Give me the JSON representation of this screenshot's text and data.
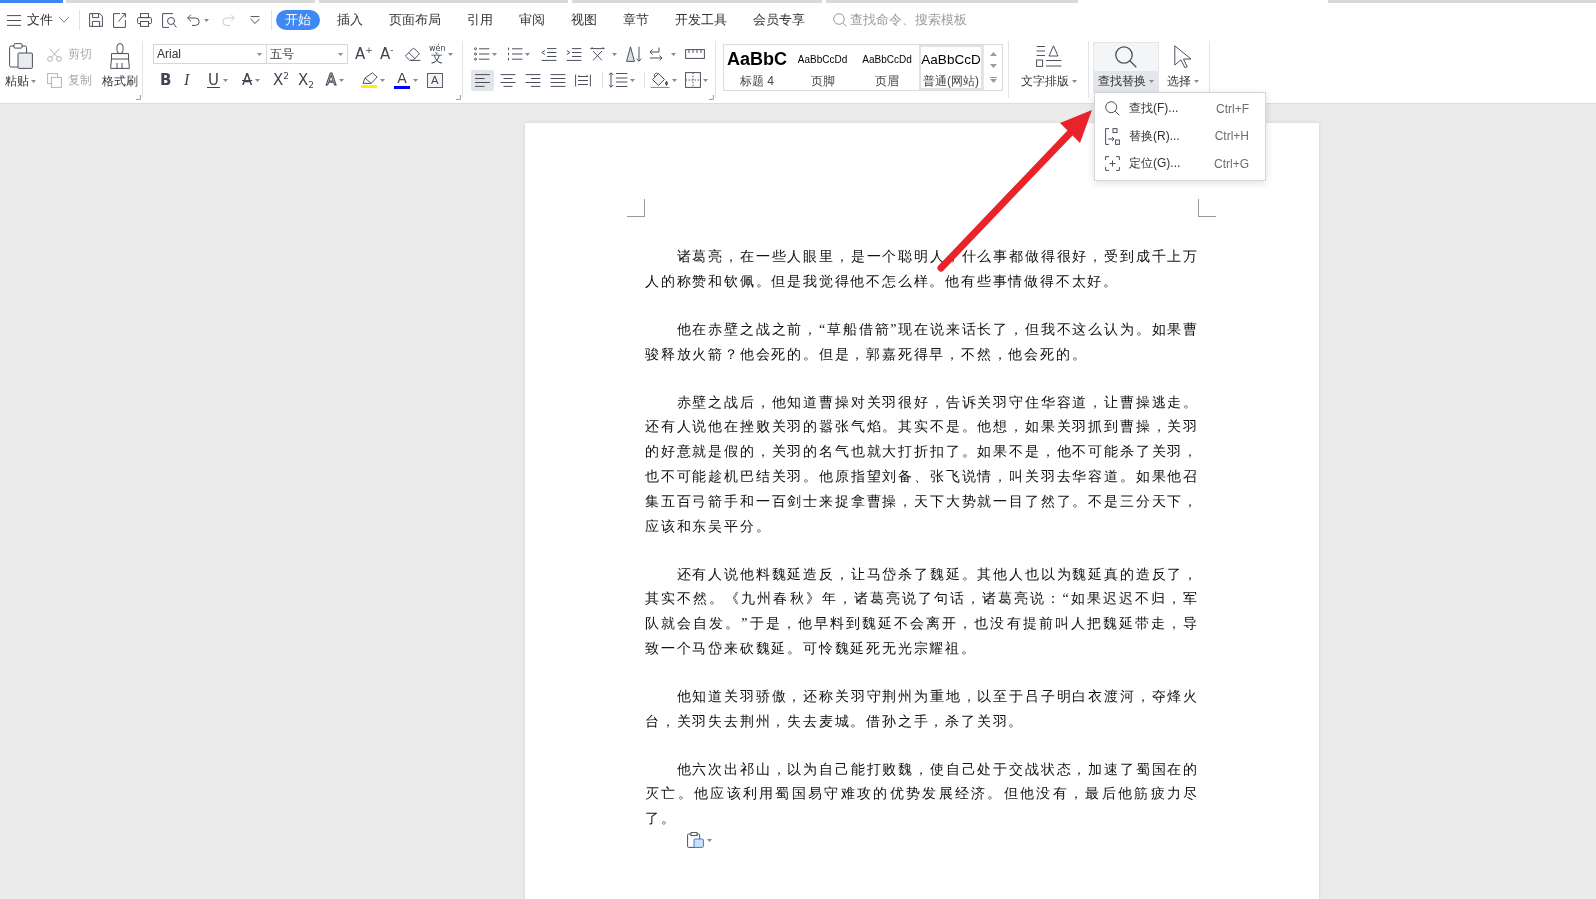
{
  "menu_bar": {
    "file_menu": "文件",
    "quick_access": [
      {
        "kind": "save",
        "disabled": false
      },
      {
        "kind": "export",
        "disabled": false
      },
      {
        "kind": "print",
        "disabled": false
      },
      {
        "kind": "print-preview",
        "disabled": false
      },
      {
        "kind": "undo",
        "disabled": false
      },
      {
        "kind": "redo",
        "disabled": true
      },
      {
        "kind": "customize",
        "disabled": false
      }
    ],
    "search": {
      "placeholder": "查找命令、搜索模板"
    }
  },
  "tabs": [
    {
      "label": "开始",
      "selected": true
    },
    {
      "label": "插入",
      "selected": false
    },
    {
      "label": "页面布局",
      "selected": false
    },
    {
      "label": "引用",
      "selected": false
    },
    {
      "label": "审阅",
      "selected": false
    },
    {
      "label": "视图",
      "selected": false
    },
    {
      "label": "章节",
      "selected": false
    },
    {
      "label": "开发工具",
      "selected": false
    },
    {
      "label": "会员专享",
      "selected": false
    }
  ],
  "ribbon": {
    "clipboard": {
      "paste": "粘贴",
      "cut": {
        "label": "剪切",
        "disabled": true
      },
      "copy": {
        "label": "复制",
        "disabled": true
      },
      "format_painter": "格式刷"
    },
    "font": {
      "font_name": "Arial",
      "font_size": "五号",
      "grow_font": "A$^{+}$",
      "shrink_font": "A$^{-}$",
      "phonetic_guide": {
        "pinyin": "wén",
        "character": "文"
      },
      "bold": "B",
      "italic": "I",
      "underline": "U",
      "strikethrough": "A",
      "superscript": "X$^{2}$",
      "subscript": "X$_{2}$",
      "text_effect": "A",
      "font_color": "A",
      "character_border": "A"
    },
    "paragraph": {
      "alignment": [
        {
          "kind": "left",
          "selected": true
        },
        {
          "kind": "center",
          "selected": false
        },
        {
          "kind": "right",
          "selected": false
        },
        {
          "kind": "justify",
          "selected": false
        },
        {
          "kind": "distributed",
          "selected": false
        }
      ]
    },
    "styles": [
      {
        "kind": "heading",
        "preview": "AaBbC",
        "label": "标题 4",
        "selected": false
      },
      {
        "kind": "footer",
        "preview": "AaBbCcDd",
        "label": "页脚",
        "selected": false
      },
      {
        "kind": "header",
        "preview": "AaBbCcDd",
        "label": "页眉",
        "selected": false
      },
      {
        "kind": "normal-web",
        "preview": "AaBbCcD",
        "label": "普通(网站)",
        "selected": true
      }
    ],
    "tools": [
      {
        "kind": "text-layout",
        "label": "文字排版",
        "expanded": false
      },
      {
        "kind": "find-replace",
        "label": "查找替换",
        "expanded": true
      },
      {
        "kind": "select",
        "label": "选择",
        "expanded": false
      }
    ]
  },
  "find_menu": [
    {
      "kind": "find",
      "label": "查找(F)...",
      "shortcut": "Ctrl+F"
    },
    {
      "kind": "replace",
      "label": "替换(R)...",
      "shortcut": "Ctrl+H"
    },
    {
      "kind": "goto",
      "label": "定位(G)...",
      "shortcut": "Ctrl+G"
    }
  ],
  "document": {
    "paragraphs": [
      "诸葛亮，在一些人眼里，是一个聪明人，什么事都做得很好，受到成千上万人的称赞和钦佩。但是我觉得他不怎么样。他有些事情做得不太好。",
      "他在赤壁之战之前，“草船借箭”现在说来话长了，但我不这么认为。如果曹骏释放火箭？他会死的。但是，郭嘉死得早，不然，他会死的。",
      "赤壁之战后，他知道曹操对关羽很好，告诉关羽守住华容道，让曹操逃走。还有人说他在挫败关羽的嚣张气焰。其实不是。他想，如果关羽抓到曹操，关羽的好意就是假的，关羽的名气也就大打折扣了。如果不是，他不可能杀了关羽，也不可能趁机巴结关羽。他原指望刘备、张飞说情，叫关羽去华容道。如果他召集五百弓箭手和一百剑士来捉拿曹操，天下大势就一目了然了。不是三分天下，应该和东吴平分。",
      "还有人说他料魏延造反，让马岱杀了魏延。其他人也以为魏延真的造反了，其实不然。《九州春秋》年，诸葛亮说了句话，诸葛亮说：“如果迟迟不归，军队就会自发。”于是，他早料到魏延不会离开，也没有提前叫人把魏延带走，导致一个马岱来砍魏延。可怜魏延死无光宗耀祖。",
      "他知道关羽骄傲，还称关羽守荆州为重地，以至于吕子明白衣渡河，夺烽火台，关羽失去荆州，失去麦城。借孙之手，杀了关羽。",
      "他六次出祁山，以为自己能打败魏，使自己处于交战状态，加速了蜀国在的灭亡。他应该利用蜀国易守难攻的优势发展经济。但他没有，最后他筋疲力尽了。"
    ]
  }
}
